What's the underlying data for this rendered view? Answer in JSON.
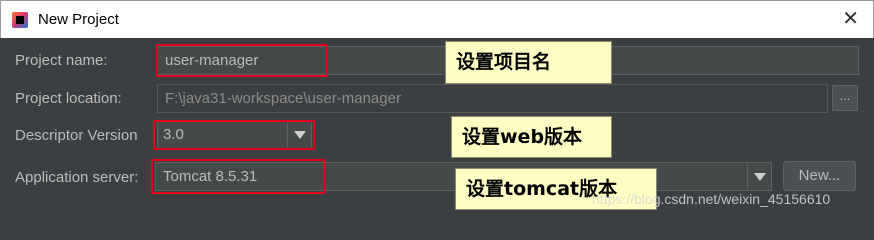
{
  "window": {
    "title": "New Project",
    "close_glyph": "✕",
    "icon": "intellij-icon"
  },
  "form": {
    "project_name_label": "Project name:",
    "project_name_value": "user-manager",
    "project_location_label": "Project location:",
    "project_location_value": "F:\\java31-workspace\\user-manager",
    "browse_label": "...",
    "descriptor_version_label": "Descriptor Version",
    "descriptor_version_value": "3.0",
    "app_server_label": "Application server:",
    "app_server_value": "Tomcat 8.5.31",
    "new_button_label": "New..."
  },
  "annotations": {
    "callout_name": "设置项目名",
    "callout_web": "设置web版本",
    "callout_tomcat": "设置tomcat版本",
    "highlight_color": "#e5001a",
    "callout_bg": "#ffffc4"
  },
  "watermark": "https://blog.csdn.net/weixin_45156610"
}
